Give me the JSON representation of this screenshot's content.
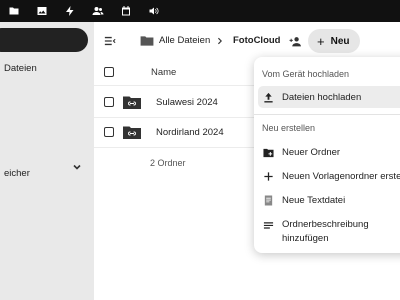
{
  "topbar": {
    "icons": [
      "files-icon",
      "photos-icon",
      "activity-icon",
      "contacts-icon",
      "calendar-icon",
      "audio-icon"
    ]
  },
  "sidebar": {
    "active_item": "",
    "items": [
      {
        "label": "Dateien"
      },
      {
        "label": "eicher"
      }
    ]
  },
  "breadcrumb": {
    "root": "Alle Dateien",
    "current": "FotoCloud"
  },
  "toolbar": {
    "new_label": "Neu"
  },
  "files": {
    "column_name": "Name",
    "rows": [
      {
        "name": "Sulawesi 2024"
      },
      {
        "name": "Nordirland 2024"
      }
    ],
    "summary": "2 Ordner"
  },
  "menu": {
    "section_upload": "Vom Gerät hochladen",
    "upload_files": "Dateien hochladen",
    "section_create": "Neu erstellen",
    "new_folder": "Neuer Ordner",
    "new_template_folder": "Neuen Vorlagenordner erstellen",
    "new_text_file": "Neue Textdatei",
    "folder_description_line1": "Ordnerbeschreibung",
    "folder_description_line2": "hinzufügen"
  }
}
